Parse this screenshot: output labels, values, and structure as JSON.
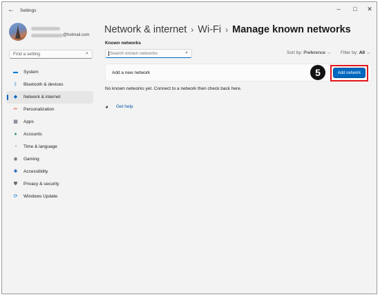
{
  "app_title": "Settings",
  "window_controls": {
    "minimize": "–",
    "maximize": "□",
    "close": "✕"
  },
  "profile": {
    "email_suffix": "@hotmail.com"
  },
  "sidebar": {
    "search_placeholder": "Find a setting",
    "items": [
      {
        "label": "System",
        "icon": "system-icon",
        "color": "#0078d4",
        "glyph": "▬"
      },
      {
        "label": "Bluetooth & devices",
        "icon": "bluetooth-icon",
        "color": "#0067c0",
        "glyph": "ᛒ"
      },
      {
        "label": "Network & internet",
        "icon": "network-icon",
        "color": "#0067c0",
        "glyph": "◆"
      },
      {
        "label": "Personalization",
        "icon": "brush-icon",
        "color": "#e05a3a",
        "glyph": "✏"
      },
      {
        "label": "Apps",
        "icon": "apps-icon",
        "color": "#555a6e",
        "glyph": "▦"
      },
      {
        "label": "Accounts",
        "icon": "accounts-icon",
        "color": "#2e9a63",
        "glyph": "●"
      },
      {
        "label": "Time & language",
        "icon": "globe-clock-icon",
        "color": "#1c7bd6",
        "glyph": "◔"
      },
      {
        "label": "Gaming",
        "icon": "gaming-icon",
        "color": "#6b6b6b",
        "glyph": "◉"
      },
      {
        "label": "Accessibility",
        "icon": "accessibility-icon",
        "color": "#1e5fb5",
        "glyph": "✱"
      },
      {
        "label": "Privacy & security",
        "icon": "shield-icon",
        "color": "#6b6b6b",
        "glyph": "⛊"
      },
      {
        "label": "Windows Update",
        "icon": "update-icon",
        "color": "#0078d4",
        "glyph": "⟳"
      }
    ],
    "selected_index": 2
  },
  "breadcrumb": {
    "part1": "Network & internet",
    "part2": "Wi-Fi",
    "current": "Manage known networks",
    "separator": "›"
  },
  "known_networks": {
    "heading": "Known networks",
    "search_placeholder": "Search known networks",
    "sort_label": "Sort by:",
    "sort_value": "Preference",
    "filter_label": "Filter by:",
    "filter_value": "All",
    "add_label": "Add a new network",
    "add_button": "Add network",
    "empty_message": "No known networks yet. Connect to a network then check back here.",
    "help_link": "Get help"
  },
  "annotation": {
    "step_number": "5",
    "highlight_color": "#e5131b"
  },
  "colors": {
    "accent": "#0067c0",
    "window_bg": "#f3f3f3"
  }
}
